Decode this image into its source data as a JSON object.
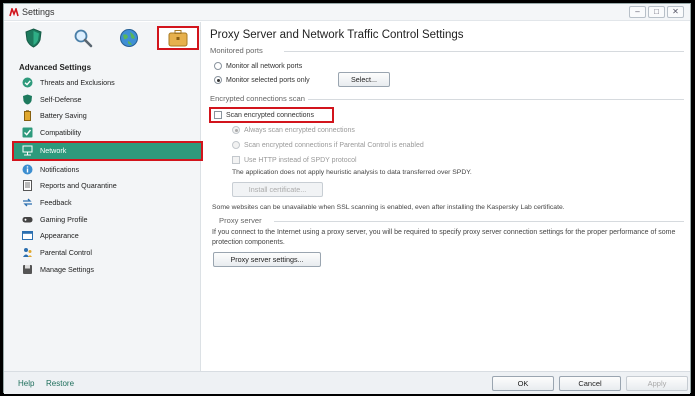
{
  "window": {
    "title": "Settings",
    "controls": [
      "minimize-icon",
      "maximize-icon",
      "close-icon"
    ]
  },
  "tabs": [
    {
      "icon": "shield-icon"
    },
    {
      "icon": "magnifier-icon"
    },
    {
      "icon": "globe-icon"
    },
    {
      "icon": "briefcase-icon",
      "active": true
    }
  ],
  "sidebar": {
    "title": "Advanced Settings",
    "items": [
      {
        "label": "Threats and Exclusions",
        "icon": "check-circle-icon"
      },
      {
        "label": "Self-Defense",
        "icon": "shield-small-icon"
      },
      {
        "label": "Battery Saving",
        "icon": "battery-icon"
      },
      {
        "label": "Compatibility",
        "icon": "checkbox-icon"
      },
      {
        "label": "Network",
        "icon": "network-icon",
        "active": true
      },
      {
        "label": "Notifications",
        "icon": "info-icon"
      },
      {
        "label": "Reports and Quarantine",
        "icon": "report-icon"
      },
      {
        "label": "Feedback",
        "icon": "feedback-icon"
      },
      {
        "label": "Gaming Profile",
        "icon": "gamepad-icon"
      },
      {
        "label": "Appearance",
        "icon": "appearance-icon"
      },
      {
        "label": "Parental Control",
        "icon": "parental-icon"
      },
      {
        "label": "Manage Settings",
        "icon": "manage-icon"
      }
    ]
  },
  "main": {
    "title": "Proxy Server and Network Traffic Control Settings",
    "monitored_ports": {
      "heading": "Monitored ports",
      "opt_all": "Monitor all network ports",
      "opt_selected": "Monitor selected ports only",
      "select_button": "Select..."
    },
    "encrypted": {
      "heading": "Encrypted connections scan",
      "scan_checkbox": "Scan encrypted connections",
      "always": "Always scan encrypted connections",
      "if_parental": "Scan encrypted connections if Parental Control is enabled",
      "use_http": "Use HTTP instead of SPDY protocol",
      "note": "The application does not apply heuristic analysis to data transferred over SPDY.",
      "install_button": "Install certificate...",
      "warning": "Some websites can be unavailable when SSL scanning is enabled, even after installing the Kaspersky Lab certificate."
    },
    "proxy": {
      "heading": "Proxy server",
      "description": "If you connect to the Internet using a proxy server, you will be required to specify proxy server connection settings for the proper performance of some protection components.",
      "button": "Proxy server settings..."
    }
  },
  "footer": {
    "help": "Help",
    "restore": "Restore",
    "ok": "OK",
    "cancel": "Cancel",
    "apply": "Apply"
  },
  "colors": {
    "accent": "#2e9a7c",
    "highlight": "#d2141c"
  }
}
